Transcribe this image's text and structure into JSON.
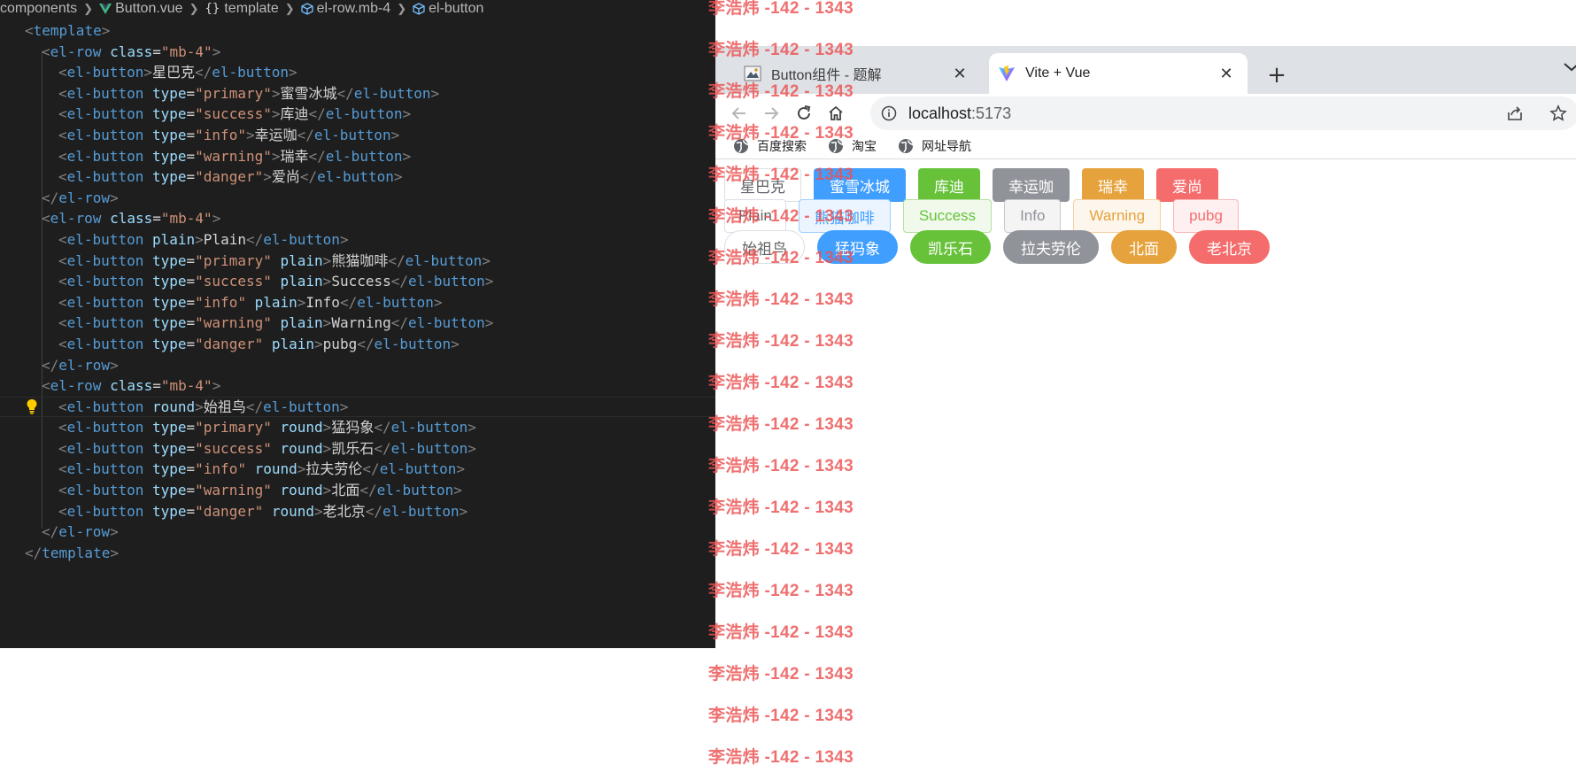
{
  "breadcrumb": {
    "items": [
      "components",
      "Button.vue",
      "template",
      "el-row.mb-4",
      "el-button"
    ],
    "icons": [
      "",
      "vue-icon",
      "braces-icon",
      "component-cube-icon",
      "component-cube-icon"
    ]
  },
  "code": {
    "lines": [
      [
        [
          "punc",
          "<"
        ],
        [
          "tag",
          "template"
        ],
        [
          "punc",
          ">"
        ]
      ],
      [
        [
          "punc",
          "<"
        ],
        [
          "tag",
          "el-row"
        ],
        [
          "text",
          " "
        ],
        [
          "attr",
          "class"
        ],
        [
          "text",
          "="
        ],
        [
          "str",
          "\"mb-4\""
        ],
        [
          "punc",
          ">"
        ]
      ],
      [
        [
          "punc",
          "<"
        ],
        [
          "tag",
          "el-button"
        ],
        [
          "punc",
          ">"
        ],
        [
          "text",
          "星巴克"
        ],
        [
          "punc",
          "</"
        ],
        [
          "tag",
          "el-button"
        ],
        [
          "punc",
          ">"
        ]
      ],
      [
        [
          "punc",
          "<"
        ],
        [
          "tag",
          "el-button"
        ],
        [
          "text",
          " "
        ],
        [
          "attr",
          "type"
        ],
        [
          "text",
          "="
        ],
        [
          "str",
          "\"primary\""
        ],
        [
          "punc",
          ">"
        ],
        [
          "text",
          "蜜雪冰城"
        ],
        [
          "punc",
          "</"
        ],
        [
          "tag",
          "el-button"
        ],
        [
          "punc",
          ">"
        ]
      ],
      [
        [
          "punc",
          "<"
        ],
        [
          "tag",
          "el-button"
        ],
        [
          "text",
          " "
        ],
        [
          "attr",
          "type"
        ],
        [
          "text",
          "="
        ],
        [
          "str",
          "\"success\""
        ],
        [
          "punc",
          ">"
        ],
        [
          "text",
          "库迪"
        ],
        [
          "punc",
          "</"
        ],
        [
          "tag",
          "el-button"
        ],
        [
          "punc",
          ">"
        ]
      ],
      [
        [
          "punc",
          "<"
        ],
        [
          "tag",
          "el-button"
        ],
        [
          "text",
          " "
        ],
        [
          "attr",
          "type"
        ],
        [
          "text",
          "="
        ],
        [
          "str",
          "\"info\""
        ],
        [
          "punc",
          ">"
        ],
        [
          "text",
          "幸运咖"
        ],
        [
          "punc",
          "</"
        ],
        [
          "tag",
          "el-button"
        ],
        [
          "punc",
          ">"
        ]
      ],
      [
        [
          "punc",
          "<"
        ],
        [
          "tag",
          "el-button"
        ],
        [
          "text",
          " "
        ],
        [
          "attr",
          "type"
        ],
        [
          "text",
          "="
        ],
        [
          "str",
          "\"warning\""
        ],
        [
          "punc",
          ">"
        ],
        [
          "text",
          "瑞幸"
        ],
        [
          "punc",
          "</"
        ],
        [
          "tag",
          "el-button"
        ],
        [
          "punc",
          ">"
        ]
      ],
      [
        [
          "punc",
          "<"
        ],
        [
          "tag",
          "el-button"
        ],
        [
          "text",
          " "
        ],
        [
          "attr",
          "type"
        ],
        [
          "text",
          "="
        ],
        [
          "str",
          "\"danger\""
        ],
        [
          "punc",
          ">"
        ],
        [
          "text",
          "爱尚"
        ],
        [
          "punc",
          "</"
        ],
        [
          "tag",
          "el-button"
        ],
        [
          "punc",
          ">"
        ]
      ],
      [
        [
          "punc",
          "</"
        ],
        [
          "tag",
          "el-row"
        ],
        [
          "punc",
          ">"
        ]
      ],
      [
        [
          "punc",
          "<"
        ],
        [
          "tag",
          "el-row"
        ],
        [
          "text",
          " "
        ],
        [
          "attr",
          "class"
        ],
        [
          "text",
          "="
        ],
        [
          "str",
          "\"mb-4\""
        ],
        [
          "punc",
          ">"
        ]
      ],
      [
        [
          "punc",
          "<"
        ],
        [
          "tag",
          "el-button"
        ],
        [
          "text",
          " "
        ],
        [
          "attr",
          "plain"
        ],
        [
          "punc",
          ">"
        ],
        [
          "text",
          "Plain"
        ],
        [
          "punc",
          "</"
        ],
        [
          "tag",
          "el-button"
        ],
        [
          "punc",
          ">"
        ]
      ],
      [
        [
          "punc",
          "<"
        ],
        [
          "tag",
          "el-button"
        ],
        [
          "text",
          " "
        ],
        [
          "attr",
          "type"
        ],
        [
          "text",
          "="
        ],
        [
          "str",
          "\"primary\""
        ],
        [
          "text",
          " "
        ],
        [
          "attr",
          "plain"
        ],
        [
          "punc",
          ">"
        ],
        [
          "text",
          "熊猫咖啡"
        ],
        [
          "punc",
          "</"
        ],
        [
          "tag",
          "el-button"
        ],
        [
          "punc",
          ">"
        ]
      ],
      [
        [
          "punc",
          "<"
        ],
        [
          "tag",
          "el-button"
        ],
        [
          "text",
          " "
        ],
        [
          "attr",
          "type"
        ],
        [
          "text",
          "="
        ],
        [
          "str",
          "\"success\""
        ],
        [
          "text",
          " "
        ],
        [
          "attr",
          "plain"
        ],
        [
          "punc",
          ">"
        ],
        [
          "text",
          "Success"
        ],
        [
          "punc",
          "</"
        ],
        [
          "tag",
          "el-button"
        ],
        [
          "punc",
          ">"
        ]
      ],
      [
        [
          "punc",
          "<"
        ],
        [
          "tag",
          "el-button"
        ],
        [
          "text",
          " "
        ],
        [
          "attr",
          "type"
        ],
        [
          "text",
          "="
        ],
        [
          "str",
          "\"info\""
        ],
        [
          "text",
          " "
        ],
        [
          "attr",
          "plain"
        ],
        [
          "punc",
          ">"
        ],
        [
          "text",
          "Info"
        ],
        [
          "punc",
          "</"
        ],
        [
          "tag",
          "el-button"
        ],
        [
          "punc",
          ">"
        ]
      ],
      [
        [
          "punc",
          "<"
        ],
        [
          "tag",
          "el-button"
        ],
        [
          "text",
          " "
        ],
        [
          "attr",
          "type"
        ],
        [
          "text",
          "="
        ],
        [
          "str",
          "\"warning\""
        ],
        [
          "text",
          " "
        ],
        [
          "attr",
          "plain"
        ],
        [
          "punc",
          ">"
        ],
        [
          "text",
          "Warning"
        ],
        [
          "punc",
          "</"
        ],
        [
          "tag",
          "el-button"
        ],
        [
          "punc",
          ">"
        ]
      ],
      [
        [
          "punc",
          "<"
        ],
        [
          "tag",
          "el-button"
        ],
        [
          "text",
          " "
        ],
        [
          "attr",
          "type"
        ],
        [
          "text",
          "="
        ],
        [
          "str",
          "\"danger\""
        ],
        [
          "text",
          " "
        ],
        [
          "attr",
          "plain"
        ],
        [
          "punc",
          ">"
        ],
        [
          "text",
          "pubg"
        ],
        [
          "punc",
          "</"
        ],
        [
          "tag",
          "el-button"
        ],
        [
          "punc",
          ">"
        ]
      ],
      [
        [
          "punc",
          "</"
        ],
        [
          "tag",
          "el-row"
        ],
        [
          "punc",
          ">"
        ]
      ],
      [
        [
          "punc",
          "<"
        ],
        [
          "tag",
          "el-row"
        ],
        [
          "text",
          " "
        ],
        [
          "attr",
          "class"
        ],
        [
          "text",
          "="
        ],
        [
          "str",
          "\"mb-4\""
        ],
        [
          "punc",
          ">"
        ]
      ],
      [
        [
          "punc",
          "<"
        ],
        [
          "tag",
          "el-button"
        ],
        [
          "text",
          " "
        ],
        [
          "attr",
          "round"
        ],
        [
          "punc",
          ">"
        ],
        [
          "text",
          "始祖鸟"
        ],
        [
          "punc",
          "</"
        ],
        [
          "tag",
          "el-button"
        ],
        [
          "punc",
          ">"
        ]
      ],
      [
        [
          "punc",
          "<"
        ],
        [
          "tag",
          "el-button"
        ],
        [
          "text",
          " "
        ],
        [
          "attr",
          "type"
        ],
        [
          "text",
          "="
        ],
        [
          "str",
          "\"primary\""
        ],
        [
          "text",
          " "
        ],
        [
          "attr",
          "round"
        ],
        [
          "punc",
          ">"
        ],
        [
          "text",
          "猛犸象"
        ],
        [
          "punc",
          "</"
        ],
        [
          "tag",
          "el-button"
        ],
        [
          "punc",
          ">"
        ]
      ],
      [
        [
          "punc",
          "<"
        ],
        [
          "tag",
          "el-button"
        ],
        [
          "text",
          " "
        ],
        [
          "attr",
          "type"
        ],
        [
          "text",
          "="
        ],
        [
          "str",
          "\"success\""
        ],
        [
          "text",
          " "
        ],
        [
          "attr",
          "round"
        ],
        [
          "punc",
          ">"
        ],
        [
          "text",
          "凯乐石"
        ],
        [
          "punc",
          "</"
        ],
        [
          "tag",
          "el-button"
        ],
        [
          "punc",
          ">"
        ]
      ],
      [
        [
          "punc",
          "<"
        ],
        [
          "tag",
          "el-button"
        ],
        [
          "text",
          " "
        ],
        [
          "attr",
          "type"
        ],
        [
          "text",
          "="
        ],
        [
          "str",
          "\"info\""
        ],
        [
          "text",
          " "
        ],
        [
          "attr",
          "round"
        ],
        [
          "punc",
          ">"
        ],
        [
          "text",
          "拉夫劳伦"
        ],
        [
          "punc",
          "</"
        ],
        [
          "tag",
          "el-button"
        ],
        [
          "punc",
          ">"
        ]
      ],
      [
        [
          "punc",
          "<"
        ],
        [
          "tag",
          "el-button"
        ],
        [
          "text",
          " "
        ],
        [
          "attr",
          "type"
        ],
        [
          "text",
          "="
        ],
        [
          "str",
          "\"warning\""
        ],
        [
          "text",
          " "
        ],
        [
          "attr",
          "round"
        ],
        [
          "punc",
          ">"
        ],
        [
          "text",
          "北面"
        ],
        [
          "punc",
          "</"
        ],
        [
          "tag",
          "el-button"
        ],
        [
          "punc",
          ">"
        ]
      ],
      [
        [
          "punc",
          "<"
        ],
        [
          "tag",
          "el-button"
        ],
        [
          "text",
          " "
        ],
        [
          "attr",
          "type"
        ],
        [
          "text",
          "="
        ],
        [
          "str",
          "\"danger\""
        ],
        [
          "text",
          " "
        ],
        [
          "attr",
          "round"
        ],
        [
          "punc",
          ">"
        ],
        [
          "text",
          "老北京"
        ],
        [
          "punc",
          "</"
        ],
        [
          "tag",
          "el-button"
        ],
        [
          "punc",
          ">"
        ]
      ],
      [
        [
          "punc",
          "</"
        ],
        [
          "tag",
          "el-row"
        ],
        [
          "punc",
          ">"
        ]
      ],
      [
        [
          "punc",
          "</"
        ],
        [
          "tag",
          "template"
        ],
        [
          "punc",
          ">"
        ]
      ]
    ],
    "indents": [
      0,
      1,
      2,
      2,
      2,
      2,
      2,
      2,
      1,
      1,
      2,
      2,
      2,
      2,
      2,
      2,
      1,
      1,
      2,
      2,
      2,
      2,
      2,
      2,
      1,
      0
    ],
    "current_line": 18,
    "lightbulb_icon": "lightbulb-icon"
  },
  "watermark": {
    "text": "李浩炜 -142 - 1343",
    "color": "#ec5050",
    "count": 19
  },
  "browser": {
    "tabs": [
      {
        "title": "Button组件 - 题解",
        "active": false,
        "favicon": "page-thumbnail-icon"
      },
      {
        "title": "Vite + Vue",
        "active": true,
        "favicon": "vite-logo-icon"
      }
    ],
    "new_tab_label": "+",
    "close_label": "✕",
    "address": {
      "host": "localhost",
      "port": ":5173"
    },
    "bookmarks": [
      {
        "label": "百度搜索",
        "icon": "globe-icon"
      },
      {
        "label": "淘宝",
        "icon": "globe-icon"
      },
      {
        "label": "网址导航",
        "icon": "globe-icon"
      }
    ]
  },
  "buttons": {
    "rows": [
      {
        "variant": "solid",
        "items": [
          {
            "label": "星巴克",
            "type": "default"
          },
          {
            "label": "蜜雪冰城",
            "type": "primary"
          },
          {
            "label": "库迪",
            "type": "success"
          },
          {
            "label": "幸运咖",
            "type": "info"
          },
          {
            "label": "瑞幸",
            "type": "warning"
          },
          {
            "label": "爱尚",
            "type": "danger"
          }
        ]
      },
      {
        "variant": "plain",
        "items": [
          {
            "label": "Plain",
            "type": "default"
          },
          {
            "label": "熊猫咖啡",
            "type": "primary"
          },
          {
            "label": "Success",
            "type": "success"
          },
          {
            "label": "Info",
            "type": "info"
          },
          {
            "label": "Warning",
            "type": "warning"
          },
          {
            "label": "pubg",
            "type": "danger"
          }
        ]
      },
      {
        "variant": "round",
        "items": [
          {
            "label": "始祖鸟",
            "type": "default"
          },
          {
            "label": "猛犸象",
            "type": "primary"
          },
          {
            "label": "凯乐石",
            "type": "success"
          },
          {
            "label": "拉夫劳伦",
            "type": "info"
          },
          {
            "label": "北面",
            "type": "warning"
          },
          {
            "label": "老北京",
            "type": "danger"
          }
        ]
      }
    ],
    "colors": {
      "primary": "#409eff",
      "success": "#67c23a",
      "info": "#909399",
      "warning": "#e6a23c",
      "danger": "#f56c6c",
      "default_border": "#dcdfe6"
    }
  }
}
